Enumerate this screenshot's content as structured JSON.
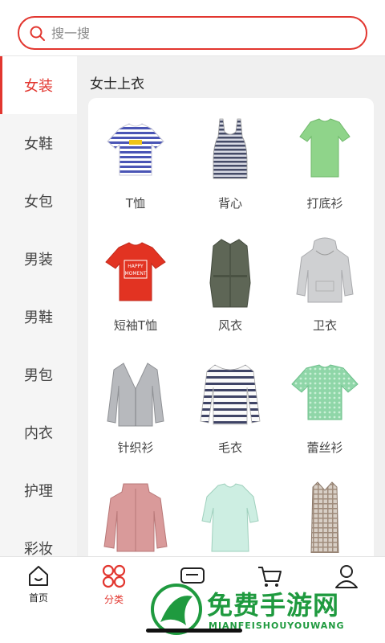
{
  "search": {
    "placeholder": "搜一搜",
    "border_color": "#e2362f"
  },
  "sidebar": {
    "items": [
      {
        "label": "女装",
        "active": true
      },
      {
        "label": "女鞋"
      },
      {
        "label": "女包"
      },
      {
        "label": "男装"
      },
      {
        "label": "男鞋"
      },
      {
        "label": "男包"
      },
      {
        "label": "内衣"
      },
      {
        "label": "护理"
      },
      {
        "label": "彩妆"
      }
    ]
  },
  "main": {
    "section_title": "女士上衣",
    "categories": [
      {
        "label": "T恤",
        "icon": "striped-tshirt-icon"
      },
      {
        "label": "背心",
        "icon": "striped-tank-icon"
      },
      {
        "label": "打底衫",
        "icon": "green-tee-icon"
      },
      {
        "label": "短袖T恤",
        "icon": "red-tshirt-icon",
        "print": [
          "HAPPY",
          "MOMENT"
        ]
      },
      {
        "label": "风衣",
        "icon": "trench-coat-icon"
      },
      {
        "label": "卫衣",
        "icon": "hoodie-icon"
      },
      {
        "label": "针织衫",
        "icon": "cardigan-icon"
      },
      {
        "label": "毛衣",
        "icon": "striped-sweater-icon"
      },
      {
        "label": "蕾丝衫",
        "icon": "lace-top-icon"
      },
      {
        "label": "",
        "icon": "pink-jacket-icon"
      },
      {
        "label": "",
        "icon": "mint-blouse-icon"
      },
      {
        "label": "",
        "icon": "plaid-long-coat-icon"
      }
    ]
  },
  "tabbar": {
    "tabs": [
      {
        "label": "首页",
        "icon": "home-icon"
      },
      {
        "label": "分类",
        "icon": "category-icon",
        "active": true
      },
      {
        "label": "",
        "icon": "truck-icon"
      },
      {
        "label": "",
        "icon": "cart-icon"
      },
      {
        "label": "",
        "icon": "user-icon"
      }
    ]
  },
  "watermark": {
    "title": "免费手游网",
    "subtitle": "MIANFEISHOUYOUWANG"
  },
  "colors": {
    "accent": "#e2362f",
    "watermark": "#1f9a3f"
  }
}
